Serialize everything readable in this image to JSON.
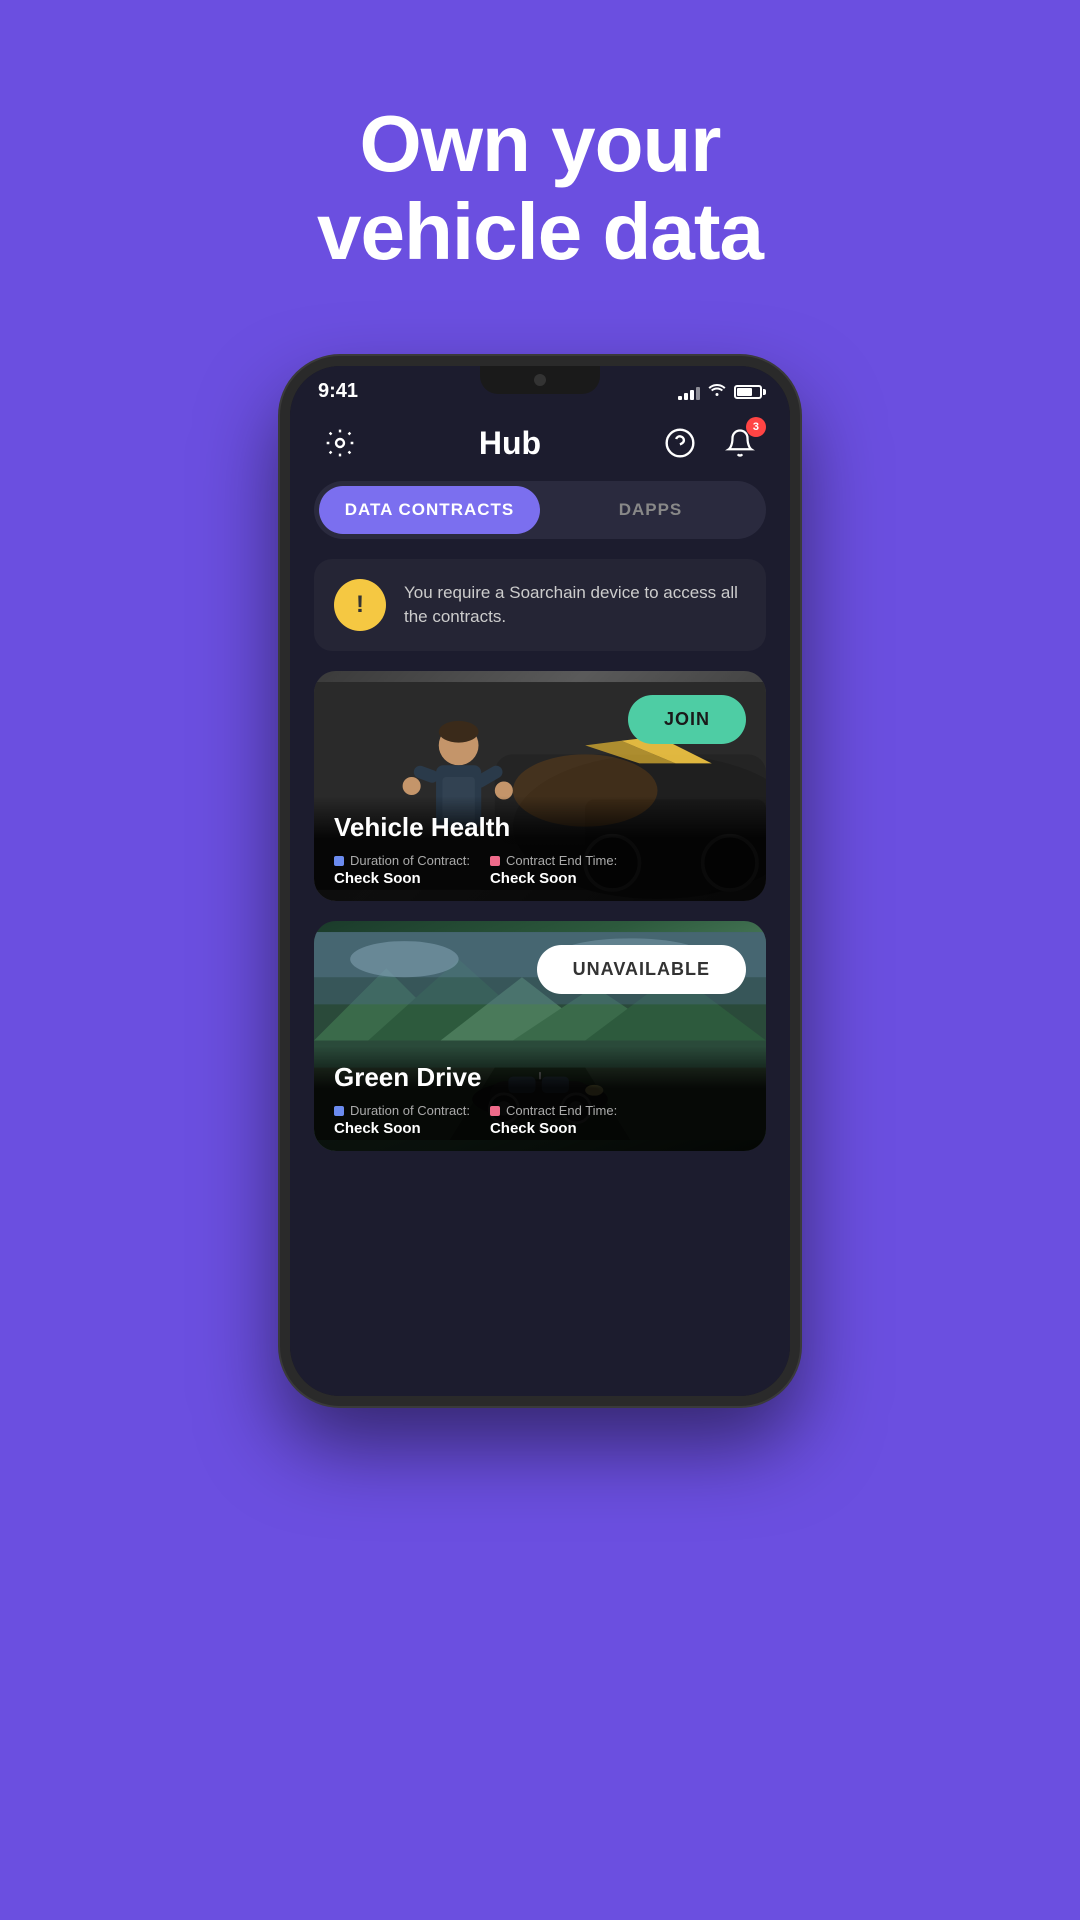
{
  "page": {
    "hero_title": "Own your\nvehicle data",
    "background_color": "#6B4FE0"
  },
  "status_bar": {
    "time": "9:41",
    "signal_bars": [
      4,
      7,
      10,
      13,
      16
    ],
    "battery_percent": 70
  },
  "header": {
    "title": "Hub",
    "notification_count": "3"
  },
  "tabs": [
    {
      "id": "data-contracts",
      "label": "DATA CONTRACTS",
      "active": true
    },
    {
      "id": "dapps",
      "label": "DAPPS",
      "active": false
    }
  ],
  "warning": {
    "icon": "!",
    "text": "You require a Soarchain device to access all the contracts."
  },
  "contracts": [
    {
      "id": "vehicle-health",
      "title": "Vehicle Health",
      "action_label": "JOIN",
      "action_type": "join",
      "duration_label": "Duration of Contract:",
      "duration_value": "Check Soon",
      "end_time_label": "Contract End Time:",
      "end_time_value": "Check Soon"
    },
    {
      "id": "green-drive",
      "title": "Green Drive",
      "action_label": "UNAVAILABLE",
      "action_type": "unavailable",
      "duration_label": "Duration of Contract:",
      "duration_value": "Check Soon",
      "end_time_label": "Contract End Time:",
      "end_time_value": "Check Soon"
    }
  ],
  "icons": {
    "gear": "⚙",
    "help": "?",
    "bell": "🔔",
    "warning": "!"
  }
}
